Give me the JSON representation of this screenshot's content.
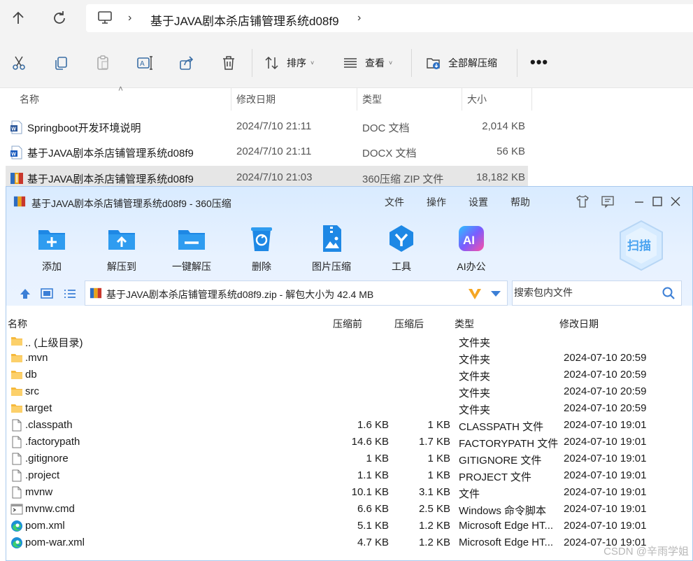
{
  "explorer": {
    "breadcrumb_path": "基于JAVA剧本杀店铺管理系统d08f9",
    "toolbar": {
      "sort_label": "排序",
      "view_label": "查看",
      "extract_all_label": "全部解压缩",
      "more_label": "•••"
    },
    "columns": {
      "name": "名称",
      "date": "修改日期",
      "type": "类型",
      "size": "大小"
    },
    "files": [
      {
        "name": "Springboot开发环境说明",
        "date": "2024/7/10 21:11",
        "type": "DOC 文档",
        "size": "2,014 KB",
        "icon": "word-doc-icon"
      },
      {
        "name": "基于JAVA剧本杀店铺管理系统d08f9",
        "date": "2024/7/10 21:11",
        "type": "DOCX 文档",
        "size": "56 KB",
        "icon": "word-docx-icon"
      },
      {
        "name": "基于JAVA剧本杀店铺管理系统d08f9",
        "date": "2024/7/10 21:03",
        "type": "360压缩 ZIP 文件",
        "size": "18,182 KB",
        "icon": "zip-archive-icon",
        "selected": true
      }
    ]
  },
  "zip_window": {
    "title": "基于JAVA剧本杀店铺管理系统d08f9 - 360压缩",
    "menu": [
      "文件",
      "操作",
      "设置",
      "帮助"
    ],
    "buttons": [
      {
        "label": "添加",
        "icon": "add-folder-icon"
      },
      {
        "label": "解压到",
        "icon": "extract-to-icon"
      },
      {
        "label": "一键解压",
        "icon": "one-click-extract-icon"
      },
      {
        "label": "删除",
        "icon": "delete-recycle-icon"
      },
      {
        "label": "图片压缩",
        "icon": "image-compress-icon"
      },
      {
        "label": "工具",
        "icon": "tools-icon"
      },
      {
        "label": "AI办公",
        "icon": "ai-office-icon"
      }
    ],
    "scan_label": "扫描",
    "path_text": "基于JAVA剧本杀店铺管理系统d08f9.zip - 解包大小为 42.4 MB",
    "search_placeholder": "搜索包内文件",
    "columns": {
      "name": "名称",
      "before": "压缩前",
      "after": "压缩后",
      "type": "类型",
      "date": "修改日期"
    },
    "entries": [
      {
        "name": ".. (上级目录)",
        "before": "",
        "after": "",
        "type": "文件夹",
        "date": "",
        "icon": "folder-icon"
      },
      {
        "name": ".mvn",
        "before": "",
        "after": "",
        "type": "文件夹",
        "date": "2024-07-10 20:59",
        "icon": "folder-icon"
      },
      {
        "name": "db",
        "before": "",
        "after": "",
        "type": "文件夹",
        "date": "2024-07-10 20:59",
        "icon": "folder-icon"
      },
      {
        "name": "src",
        "before": "",
        "after": "",
        "type": "文件夹",
        "date": "2024-07-10 20:59",
        "icon": "folder-icon"
      },
      {
        "name": "target",
        "before": "",
        "after": "",
        "type": "文件夹",
        "date": "2024-07-10 20:59",
        "icon": "folder-icon"
      },
      {
        "name": ".classpath",
        "before": "1.6 KB",
        "after": "1 KB",
        "type": "CLASSPATH 文件",
        "date": "2024-07-10 19:01",
        "icon": "file-icon"
      },
      {
        "name": ".factorypath",
        "before": "14.6 KB",
        "after": "1.7 KB",
        "type": "FACTORYPATH 文件",
        "date": "2024-07-10 19:01",
        "icon": "file-icon"
      },
      {
        "name": ".gitignore",
        "before": "1 KB",
        "after": "1 KB",
        "type": "GITIGNORE 文件",
        "date": "2024-07-10 19:01",
        "icon": "file-icon"
      },
      {
        "name": ".project",
        "before": "1.1 KB",
        "after": "1 KB",
        "type": "PROJECT 文件",
        "date": "2024-07-10 19:01",
        "icon": "file-icon"
      },
      {
        "name": "mvnw",
        "before": "10.1 KB",
        "after": "3.1 KB",
        "type": "文件",
        "date": "2024-07-10 19:01",
        "icon": "file-icon"
      },
      {
        "name": "mvnw.cmd",
        "before": "6.6 KB",
        "after": "2.5 KB",
        "type": "Windows 命令脚本",
        "date": "2024-07-10 19:01",
        "icon": "cmd-script-icon"
      },
      {
        "name": "pom.xml",
        "before": "5.1 KB",
        "after": "1.2 KB",
        "type": "Microsoft Edge HT...",
        "date": "2024-07-10 19:01",
        "icon": "edge-icon"
      },
      {
        "name": "pom-war.xml",
        "before": "4.7 KB",
        "after": "1.2 KB",
        "type": "Microsoft Edge HT...",
        "date": "2024-07-10 19:01",
        "icon": "edge-icon"
      }
    ]
  },
  "watermark": "CSDN @辛雨学姐"
}
